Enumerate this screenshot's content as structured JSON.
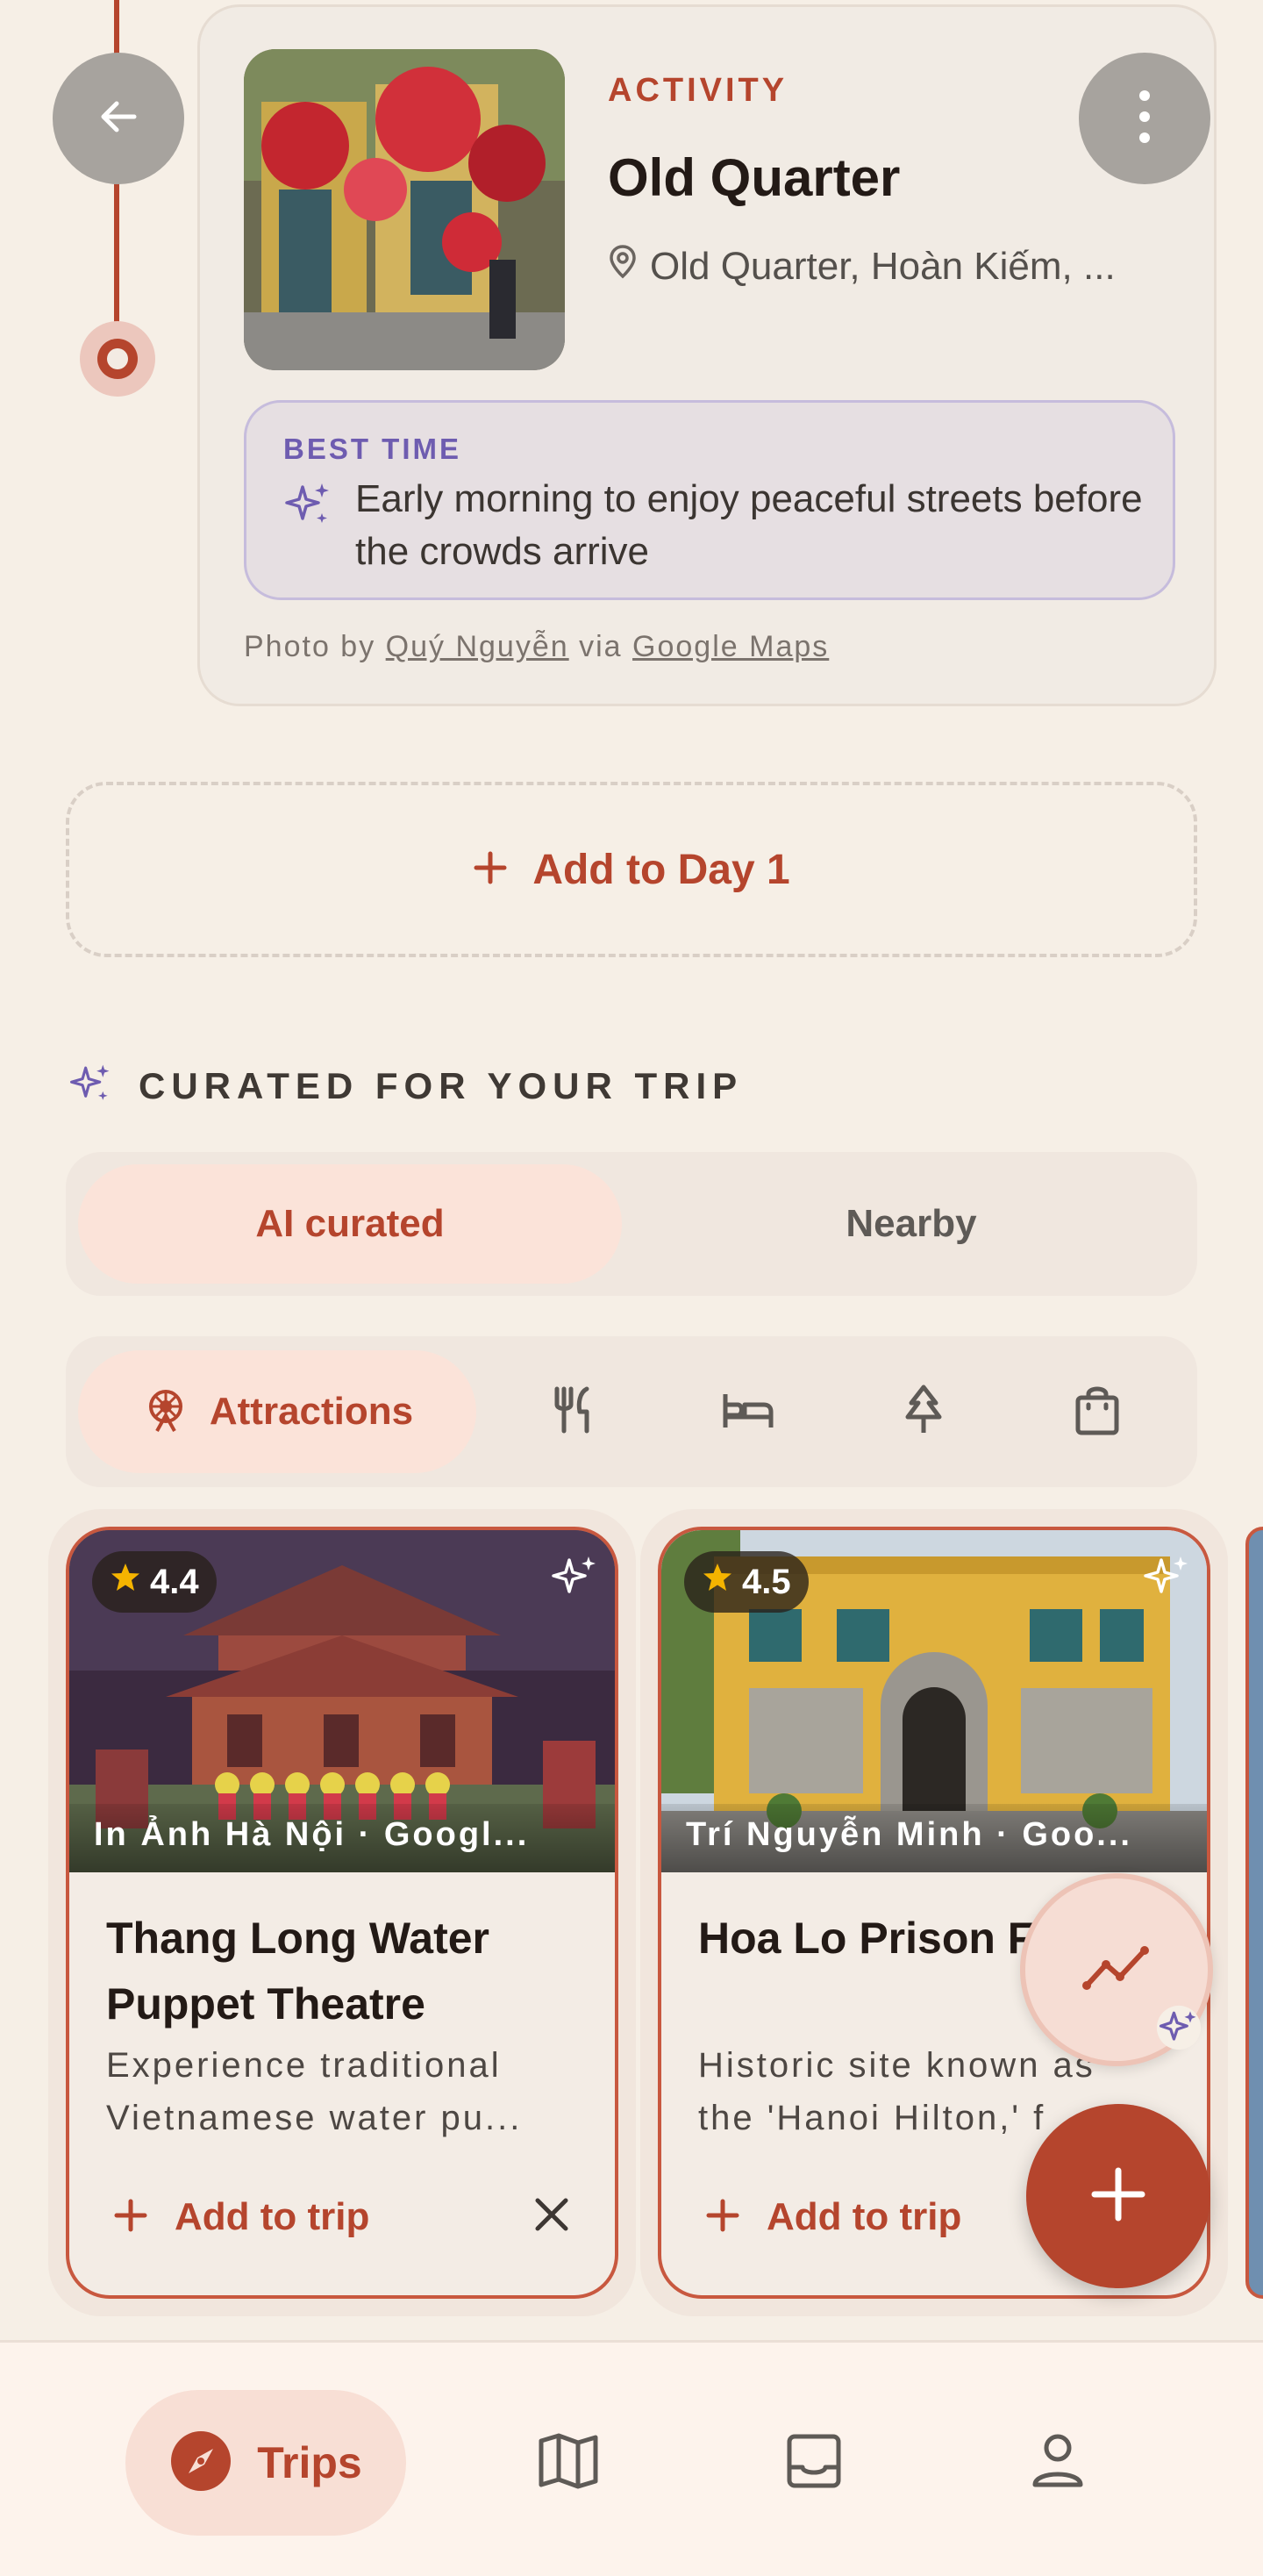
{
  "activity": {
    "kind": "ACTIVITY",
    "title": "Old Quarter",
    "location": "Old Quarter, Hoàn Kiếm, ...",
    "best_time_label": "BEST TIME",
    "best_time_text": "Early morning to enjoy peaceful streets before the crowds arrive",
    "photo_credit_prefix": "Photo by",
    "photo_credit_author": "Quý Nguyễn",
    "photo_credit_via": "via",
    "photo_credit_source": "Google Maps"
  },
  "add_day": {
    "label": "Add to Day 1"
  },
  "curated": {
    "title": "CURATED FOR YOUR TRIP",
    "segments": [
      "AI curated",
      "Nearby"
    ],
    "active_segment": "AI curated",
    "active_category": "Attractions",
    "category_icons": [
      "attractions-icon",
      "restaurant-icon",
      "hotel-icon",
      "nature-icon",
      "shopping-icon"
    ]
  },
  "places": [
    {
      "rating": "4.4",
      "photo_caption": "In Ảnh Hà Nội · Googl...",
      "title": "Thang Long Water Puppet Theatre",
      "desc_line1": "Experience traditional",
      "desc_line2": "Vietnamese water pu...",
      "add_label": "Add to trip"
    },
    {
      "rating": "4.5",
      "photo_caption": "Trí Nguyễn Minh · Goo...",
      "title": "Hoa Lo Prison F",
      "desc_line1": "Historic site known as",
      "desc_line2": "the 'Hanoi Hilton,' f",
      "add_label": "Add to trip"
    }
  ],
  "nav": {
    "active": "Trips",
    "items": [
      "Trips",
      "map-icon",
      "inbox-icon",
      "profile-icon"
    ]
  },
  "colors": {
    "accent": "#b5452d",
    "background": "#f6efe6",
    "ai_purple": "#6e5cb0",
    "star": "#f5b400"
  }
}
